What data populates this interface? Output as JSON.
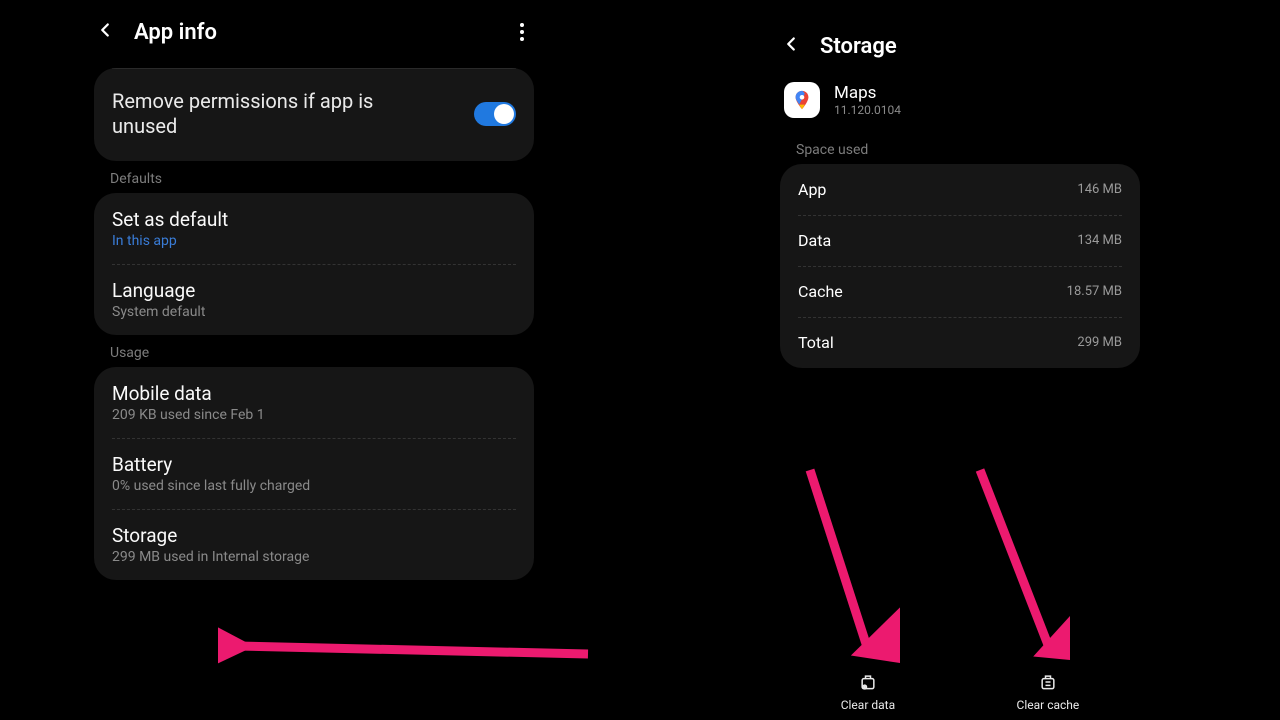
{
  "left": {
    "header": {
      "title": "App info"
    },
    "permission": {
      "label": "Remove permissions if app is unused",
      "on": true
    },
    "sections": {
      "defaults": {
        "label": "Defaults",
        "items": [
          {
            "title": "Set as default",
            "sub": "In this app",
            "link": true
          },
          {
            "title": "Language",
            "sub": "System default"
          }
        ]
      },
      "usage": {
        "label": "Usage",
        "items": [
          {
            "title": "Mobile data",
            "sub": "209 KB used since Feb 1"
          },
          {
            "title": "Battery",
            "sub": "0% used since last fully charged"
          },
          {
            "title": "Storage",
            "sub": "299 MB used in Internal storage"
          }
        ]
      }
    }
  },
  "right": {
    "header": {
      "title": "Storage"
    },
    "app": {
      "name": "Maps",
      "version": "11.120.0104"
    },
    "space": {
      "label": "Space used",
      "rows": [
        {
          "label": "App",
          "value": "146 MB"
        },
        {
          "label": "Data",
          "value": "134 MB"
        },
        {
          "label": "Cache",
          "value": "18.57 MB"
        },
        {
          "label": "Total",
          "value": "299 MB"
        }
      ]
    },
    "actions": {
      "clear_data": "Clear data",
      "clear_cache": "Clear cache"
    }
  }
}
